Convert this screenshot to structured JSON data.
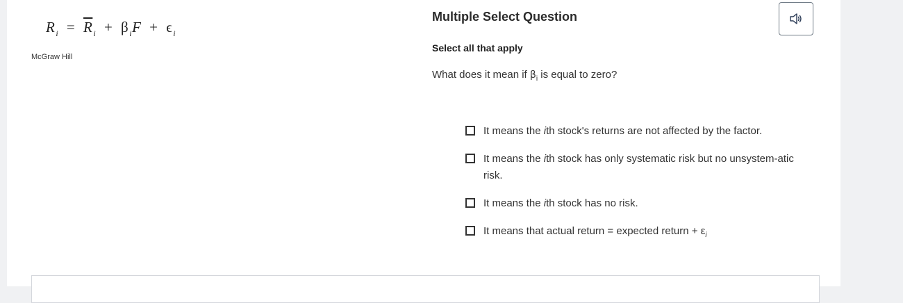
{
  "equation": {
    "r": "R",
    "r_sub": "i",
    "equals": "=",
    "rbar": "R",
    "rbar_sub": "i",
    "plus1": "+",
    "beta": "β",
    "beta_sub": "i",
    "f": "F",
    "plus2": "+",
    "eps": "ϵ",
    "eps_sub": "i"
  },
  "credit": "McGraw Hill",
  "question_type": "Multiple Select Question",
  "instruction": "Select all that apply",
  "question": {
    "pre": "What does it mean if ",
    "beta": "β",
    "beta_sub": "i",
    "post": " is equal to zero?"
  },
  "audio_icon": "speaker-icon",
  "options": [
    {
      "pre": "It means the ",
      "ital": "i",
      "post": "th stock's returns are not affected by the factor."
    },
    {
      "pre": "It means the ",
      "ital": "i",
      "post": "th stock has only systematic risk but no unsystem-atic risk."
    },
    {
      "pre": "It means the ",
      "ital": "i",
      "post": "th stock has no risk."
    },
    {
      "pre": "It means that actual return = expected return + ",
      "eps": "ε",
      "eps_sub": "i"
    }
  ]
}
